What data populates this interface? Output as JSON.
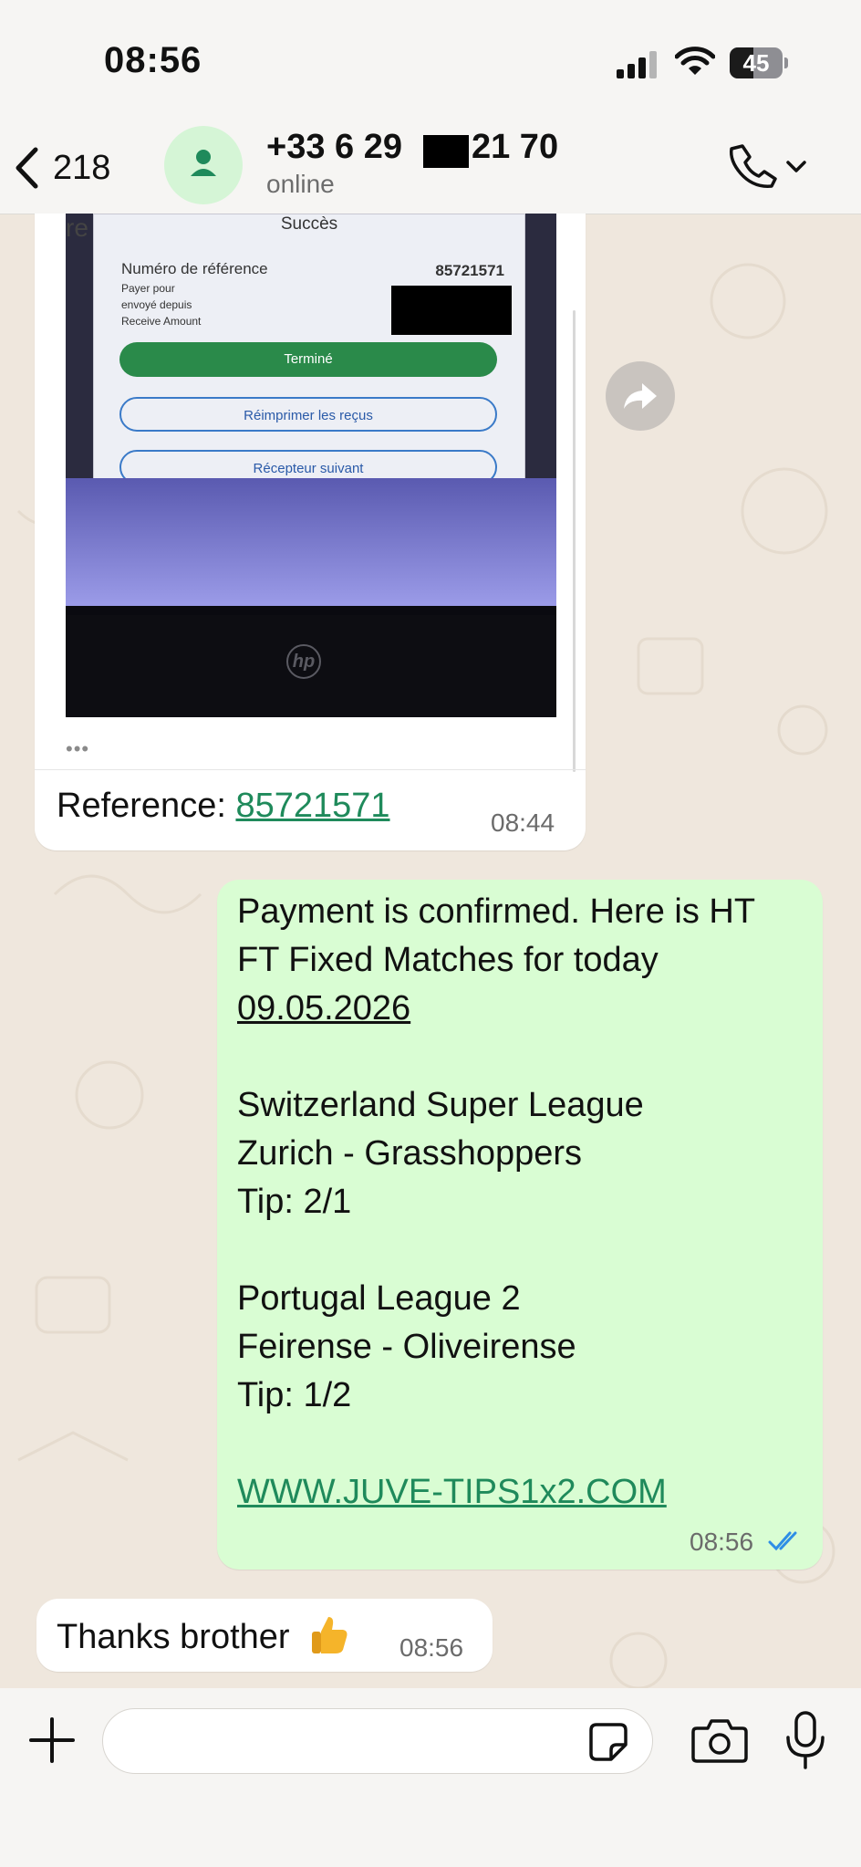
{
  "status_bar": {
    "time": "08:56",
    "battery": "45"
  },
  "header": {
    "back_count": "218",
    "contact_name_prefix": "+33 6 29",
    "contact_name_suffix": "21 70",
    "contact_status": "online"
  },
  "messages": {
    "image_message": {
      "photo_screen": {
        "title": "Succès",
        "ref_label": "Numéro de référence",
        "ref_value": "85721571",
        "row1": "Payer pour",
        "row2": "envoyé depuis",
        "row3": "Receive Amount",
        "btn_done": "Terminé",
        "btn_reprint": "Réimprimer les reçus",
        "btn_next": "Récepteur suivant",
        "side_fragment": "re",
        "laptop_logo": "hp"
      },
      "more_dots": "•••",
      "caption_label": "Reference: ",
      "caption_link": "85721571",
      "time": "08:44"
    },
    "outgoing": {
      "lines": {
        "l1": "Payment is confirmed. Here is HT",
        "l2": "FT Fixed Matches for today",
        "l3": "09.05.2026",
        "l4": "Switzerland Super League",
        "l5": "Zurich - Grasshoppers",
        "l6": "Tip: 2/1",
        "l7": "Portugal League 2",
        "l8": "Feirense - Oliveirense",
        "l9": "Tip: 1/2",
        "l10": "WWW.JUVE-TIPS1x2.COM"
      },
      "time": "08:56"
    },
    "incoming_reply": {
      "text": "Thanks brother",
      "time": "08:56"
    }
  },
  "input": {
    "placeholder": ""
  },
  "colors": {
    "accent_green": "#1f8a5b",
    "outgoing_bubble": "#d9fdd3",
    "incoming_bubble": "#ffffff",
    "read_ticks": "#2e8ee6",
    "chat_background": "#efe7dd"
  },
  "icons": {
    "back": "chevron-left-icon",
    "avatar": "person-icon",
    "call": "phone-icon",
    "forward": "share-forward-icon",
    "ticks": "double-check-icon",
    "plus": "plus-icon",
    "sticker": "sticker-icon",
    "camera": "camera-icon",
    "mic": "microphone-icon"
  }
}
